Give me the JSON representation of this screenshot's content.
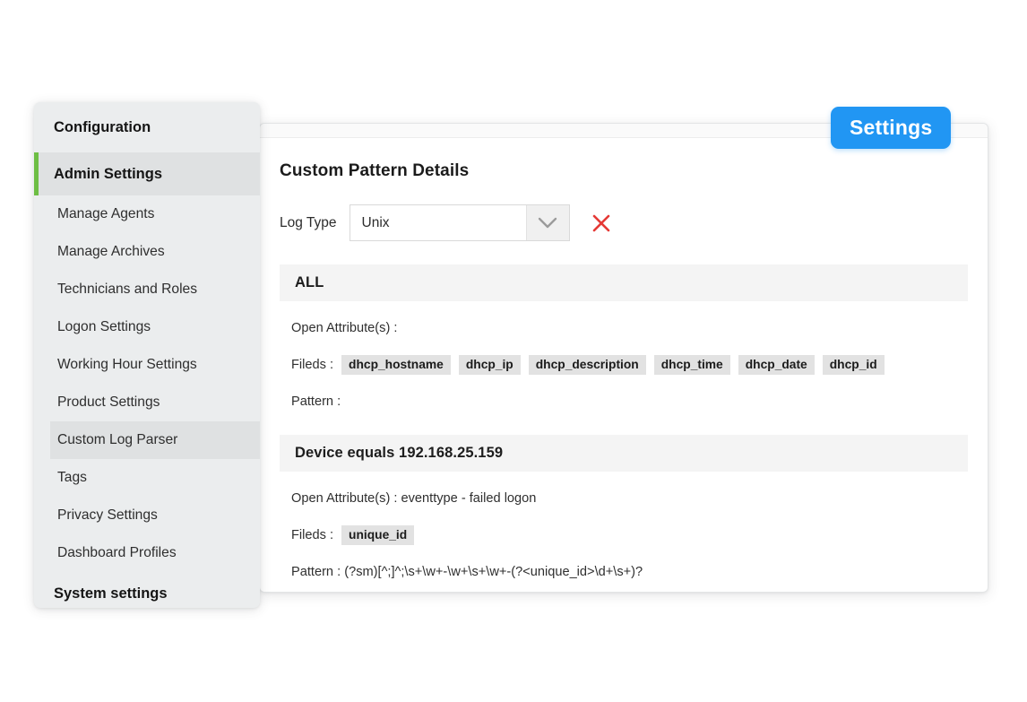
{
  "badge": {
    "label": "Settings"
  },
  "sidebar": {
    "header": "Configuration",
    "active": "Admin Settings",
    "items": [
      {
        "label": "Manage Agents",
        "selected": false
      },
      {
        "label": "Manage Archives",
        "selected": false
      },
      {
        "label": "Technicians and Roles",
        "selected": false
      },
      {
        "label": "Logon Settings",
        "selected": false
      },
      {
        "label": "Working Hour Settings",
        "selected": false
      },
      {
        "label": "Product Settings",
        "selected": false
      },
      {
        "label": "Custom Log Parser",
        "selected": true
      },
      {
        "label": "Tags",
        "selected": false
      },
      {
        "label": "Privacy Settings",
        "selected": false
      },
      {
        "label": "Dashboard Profiles",
        "selected": false
      }
    ],
    "footer": "System settings"
  },
  "panel": {
    "title": "Custom Pattern Details",
    "log_type": {
      "label": "Log Type",
      "value": "Unix",
      "options": [
        "Unix"
      ],
      "dropdown_icon": "chevron-down-icon",
      "remove_icon": "close-x-icon",
      "remove_color": "#e53935"
    },
    "sections": [
      {
        "header": "ALL",
        "open_attributes_label": "Open Attribute(s) :",
        "open_attributes_value": "",
        "fields_label": "Fileds :",
        "fields": [
          "dhcp_hostname",
          "dhcp_ip",
          "dhcp_description",
          "dhcp_time",
          "dhcp_date",
          "dhcp_id"
        ],
        "pattern_label": "Pattern :",
        "pattern_value": ""
      },
      {
        "header": "Device equals 192.168.25.159",
        "open_attributes_label": "Open Attribute(s) :",
        "open_attributes_value": " eventtype - failed logon",
        "fields_label": "Fileds :",
        "fields": [
          "unique_id"
        ],
        "pattern_label": "Pattern :",
        "pattern_value": " (?sm)[^;]^;\\s+\\w+-\\w+\\s+\\w+-(?<unique_id>\\d+\\s+)?"
      }
    ]
  },
  "colors": {
    "accent_green": "#6ebe44",
    "badge_blue": "#2196f3",
    "chip_grey": "#e2e2e2",
    "section_header_grey": "#f4f4f4",
    "sidebar_grey": "#ebedee"
  }
}
